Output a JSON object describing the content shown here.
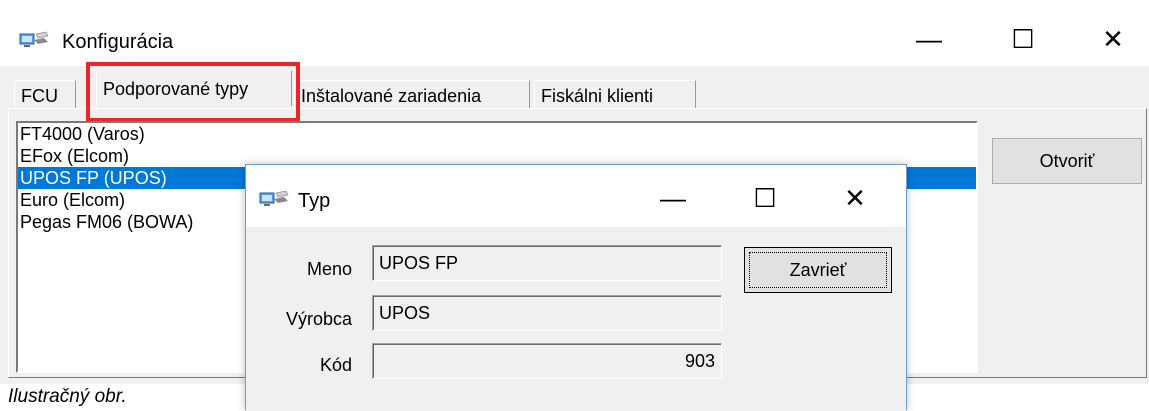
{
  "main_window": {
    "title": "Konfigurácia",
    "icon": "computer-network-icon",
    "controls": {
      "minimize": "—",
      "maximize": "☐",
      "close": "✕"
    }
  },
  "tabs": [
    {
      "label": "FCU"
    },
    {
      "label": "Podporované typy",
      "active": true
    },
    {
      "label": "Inštalované zariadenia"
    },
    {
      "label": "Fiskálni klienti"
    }
  ],
  "device_types": [
    {
      "label": "FT4000 (Varos)"
    },
    {
      "label": "EFox (Elcom)"
    },
    {
      "label": "UPOS FP (UPOS)",
      "selected": true
    },
    {
      "label": "Euro (Elcom)"
    },
    {
      "label": "Pegas FM06 (BOWA)"
    }
  ],
  "open_button": "Otvoriť",
  "dialog": {
    "title": "Typ",
    "icon": "computer-network-icon",
    "controls": {
      "minimize": "—",
      "maximize": "☐",
      "close": "✕"
    },
    "fields": {
      "name": {
        "label": "Meno",
        "value": "UPOS FP"
      },
      "manufacturer": {
        "label": "Výrobca",
        "value": "UPOS"
      },
      "code": {
        "label": "Kód",
        "value": "903"
      }
    },
    "close_button": "Zavrieť"
  },
  "caption": "Ilustračný obr.",
  "colors": {
    "selection": "#0078d7",
    "highlight": "#e8262b",
    "panel": "#f0f0f0"
  }
}
